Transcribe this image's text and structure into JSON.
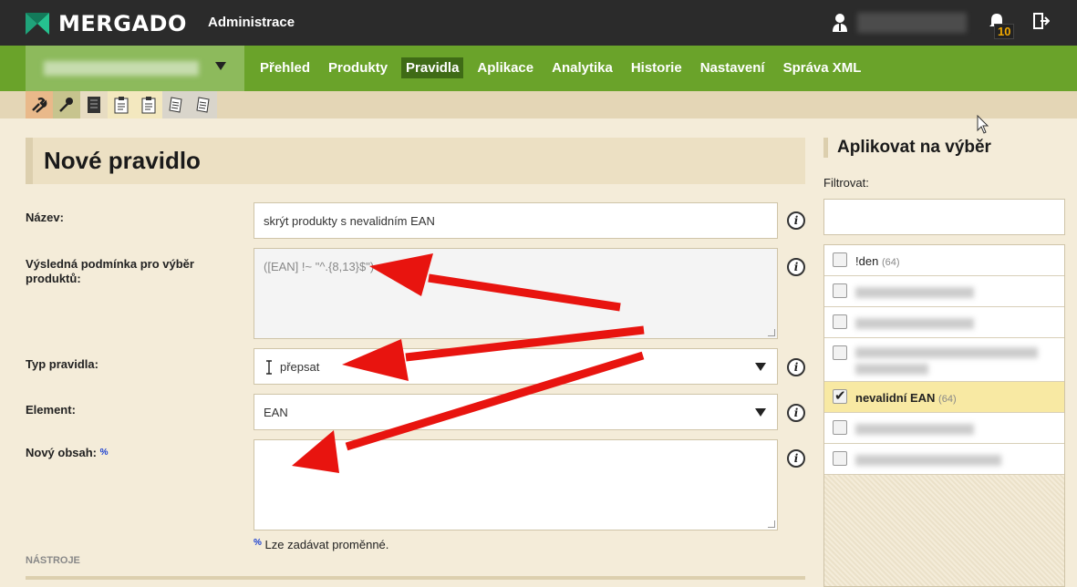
{
  "topbar": {
    "logo_text": "MERGADO",
    "admin_label": "Administrace",
    "notifications_count": "10"
  },
  "nav": {
    "items": [
      "Přehled",
      "Produkty",
      "Pravidla",
      "Aplikace",
      "Analytika",
      "Historie",
      "Nastavení",
      "Správa XML"
    ],
    "active": "Pravidla"
  },
  "page": {
    "title": "Nové pravidlo"
  },
  "form": {
    "name_label": "Název:",
    "name_value": "skrýt produkty s nevalidním EAN",
    "condition_label": "Výsledná podmínka pro výběr produktů:",
    "condition_value": "([EAN] !~ \"^.{8,13}$\")",
    "rule_type_label": "Typ pravidla:",
    "rule_type_value": "přepsat",
    "element_label": "Element:",
    "element_value": "EAN",
    "new_content_label": "Nový obsah:",
    "new_content_pct": "%",
    "new_content_value": "",
    "variables_hint_pct": "%",
    "variables_hint": "Lze zadávat proměnné.",
    "tools_label": "NÁSTROJE",
    "info_glyph": "i"
  },
  "right_panel": {
    "title": "Aplikovat na výběr",
    "filter_label": "Filtrovat:",
    "filter_value": "",
    "items": [
      {
        "label": "!den",
        "count": "(64)",
        "checked": false
      },
      {
        "label": "nevalidní EAN",
        "count": "(64)",
        "checked": true
      }
    ]
  },
  "colors": {
    "topbar": "#2b2b2b",
    "nav_green": "#6aa32a",
    "nav_active": "#3f6b16",
    "background": "#f4ecd9",
    "arrow_red": "#e8140f",
    "checked_row": "#f8e9a3"
  }
}
